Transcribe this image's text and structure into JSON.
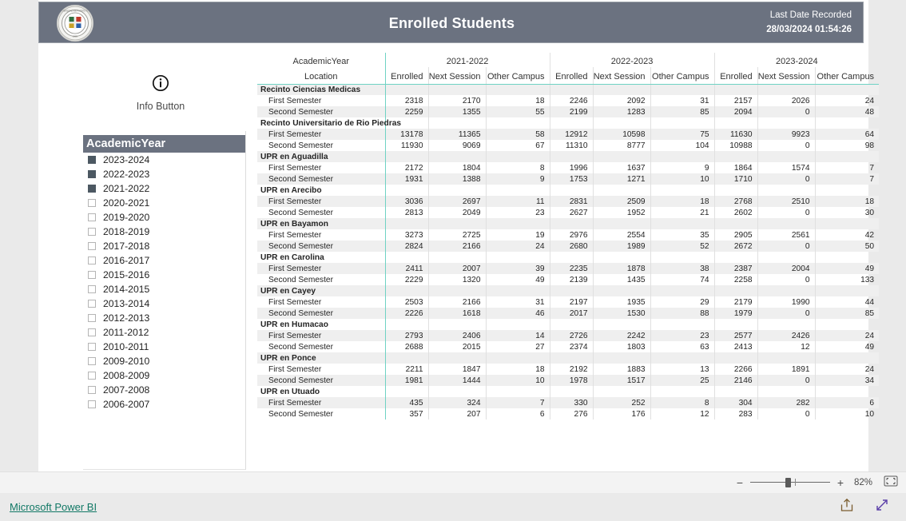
{
  "header": {
    "title": "Enrolled Students",
    "date_label": "Last Date Recorded",
    "date_value": "28/03/2024 01:54:26",
    "logo_name": "university-seal-logo",
    "bg_color": "#6b7280"
  },
  "info_button": {
    "label": "Info Button",
    "icon": "info-circle-icon"
  },
  "slicer": {
    "title": "AcademicYear",
    "items": [
      {
        "label": "2023-2024",
        "checked": true
      },
      {
        "label": "2022-2023",
        "checked": true
      },
      {
        "label": "2021-2022",
        "checked": true
      },
      {
        "label": "2020-2021",
        "checked": false
      },
      {
        "label": "2019-2020",
        "checked": false
      },
      {
        "label": "2018-2019",
        "checked": false
      },
      {
        "label": "2017-2018",
        "checked": false
      },
      {
        "label": "2016-2017",
        "checked": false
      },
      {
        "label": "2015-2016",
        "checked": false
      },
      {
        "label": "2014-2015",
        "checked": false
      },
      {
        "label": "2013-2014",
        "checked": false
      },
      {
        "label": "2012-2013",
        "checked": false
      },
      {
        "label": "2011-2012",
        "checked": false
      },
      {
        "label": "2010-2011",
        "checked": false
      },
      {
        "label": "2009-2010",
        "checked": false
      },
      {
        "label": "2008-2009",
        "checked": false
      },
      {
        "label": "2007-2008",
        "checked": false
      },
      {
        "label": "2006-2007",
        "checked": false
      }
    ]
  },
  "matrix": {
    "corner_top": "AcademicYear",
    "corner_bottom": "Location",
    "year_groups": [
      "2021-2022",
      "2022-2023",
      "2023-2024"
    ],
    "measures": [
      "Enrolled",
      "Next Session",
      "Other Campus"
    ],
    "accent_line_color": "#6fd2c4",
    "rows": [
      {
        "type": "group",
        "label": "Recinto Ciencias Medicas",
        "values": [
          "",
          "",
          "",
          "",
          "",
          "",
          "",
          "",
          ""
        ]
      },
      {
        "type": "item",
        "label": "First Semester",
        "values": [
          "2318",
          "2170",
          "18",
          "2246",
          "2092",
          "31",
          "2157",
          "2026",
          "24"
        ]
      },
      {
        "type": "item",
        "label": "Second Semester",
        "values": [
          "2259",
          "1355",
          "55",
          "2199",
          "1283",
          "85",
          "2094",
          "0",
          "48"
        ]
      },
      {
        "type": "group",
        "label": "Recinto Universitario de Rio Piedras",
        "values": [
          "",
          "",
          "",
          "",
          "",
          "",
          "",
          "",
          ""
        ]
      },
      {
        "type": "item",
        "label": "First Semester",
        "values": [
          "13178",
          "11365",
          "58",
          "12912",
          "10598",
          "75",
          "11630",
          "9923",
          "64"
        ]
      },
      {
        "type": "item",
        "label": "Second Semester",
        "values": [
          "11930",
          "9069",
          "67",
          "11310",
          "8777",
          "104",
          "10988",
          "0",
          "98"
        ]
      },
      {
        "type": "group",
        "label": "UPR en Aguadilla",
        "values": [
          "",
          "",
          "",
          "",
          "",
          "",
          "",
          "",
          ""
        ]
      },
      {
        "type": "item",
        "label": "First Semester",
        "values": [
          "2172",
          "1804",
          "8",
          "1996",
          "1637",
          "9",
          "1864",
          "1574",
          "7"
        ]
      },
      {
        "type": "item",
        "label": "Second Semester",
        "values": [
          "1931",
          "1388",
          "9",
          "1753",
          "1271",
          "10",
          "1710",
          "0",
          "7"
        ]
      },
      {
        "type": "group",
        "label": "UPR en Arecibo",
        "values": [
          "",
          "",
          "",
          "",
          "",
          "",
          "",
          "",
          ""
        ]
      },
      {
        "type": "item",
        "label": "First Semester",
        "values": [
          "3036",
          "2697",
          "11",
          "2831",
          "2509",
          "18",
          "2768",
          "2510",
          "18"
        ]
      },
      {
        "type": "item",
        "label": "Second Semester",
        "values": [
          "2813",
          "2049",
          "23",
          "2627",
          "1952",
          "21",
          "2602",
          "0",
          "30"
        ]
      },
      {
        "type": "group",
        "label": "UPR en Bayamon",
        "values": [
          "",
          "",
          "",
          "",
          "",
          "",
          "",
          "",
          ""
        ]
      },
      {
        "type": "item",
        "label": "First Semester",
        "values": [
          "3273",
          "2725",
          "19",
          "2976",
          "2554",
          "35",
          "2905",
          "2561",
          "42"
        ]
      },
      {
        "type": "item",
        "label": "Second Semester",
        "values": [
          "2824",
          "2166",
          "24",
          "2680",
          "1989",
          "52",
          "2672",
          "0",
          "50"
        ]
      },
      {
        "type": "group",
        "label": "UPR en Carolina",
        "values": [
          "",
          "",
          "",
          "",
          "",
          "",
          "",
          "",
          ""
        ]
      },
      {
        "type": "item",
        "label": "First Semester",
        "values": [
          "2411",
          "2007",
          "39",
          "2235",
          "1878",
          "38",
          "2387",
          "2004",
          "49"
        ]
      },
      {
        "type": "item",
        "label": "Second Semester",
        "values": [
          "2229",
          "1320",
          "49",
          "2139",
          "1435",
          "74",
          "2258",
          "0",
          "133"
        ]
      },
      {
        "type": "group",
        "label": "UPR en Cayey",
        "values": [
          "",
          "",
          "",
          "",
          "",
          "",
          "",
          "",
          ""
        ]
      },
      {
        "type": "item",
        "label": "First Semester",
        "values": [
          "2503",
          "2166",
          "31",
          "2197",
          "1935",
          "29",
          "2179",
          "1990",
          "44"
        ]
      },
      {
        "type": "item",
        "label": "Second Semester",
        "values": [
          "2226",
          "1618",
          "46",
          "2017",
          "1530",
          "88",
          "1979",
          "0",
          "85"
        ]
      },
      {
        "type": "group",
        "label": "UPR en Humacao",
        "values": [
          "",
          "",
          "",
          "",
          "",
          "",
          "",
          "",
          ""
        ]
      },
      {
        "type": "item",
        "label": "First Semester",
        "values": [
          "2793",
          "2406",
          "14",
          "2726",
          "2242",
          "23",
          "2577",
          "2426",
          "24"
        ]
      },
      {
        "type": "item",
        "label": "Second Semester",
        "values": [
          "2688",
          "2015",
          "27",
          "2374",
          "1803",
          "63",
          "2413",
          "12",
          "49"
        ]
      },
      {
        "type": "group",
        "label": "UPR en Ponce",
        "values": [
          "",
          "",
          "",
          "",
          "",
          "",
          "",
          "",
          ""
        ]
      },
      {
        "type": "item",
        "label": "First Semester",
        "values": [
          "2211",
          "1847",
          "18",
          "2192",
          "1883",
          "13",
          "2266",
          "1891",
          "24"
        ]
      },
      {
        "type": "item",
        "label": "Second Semester",
        "values": [
          "1981",
          "1444",
          "10",
          "1978",
          "1517",
          "25",
          "2146",
          "0",
          "34"
        ]
      },
      {
        "type": "group",
        "label": "UPR en Utuado",
        "values": [
          "",
          "",
          "",
          "",
          "",
          "",
          "",
          "",
          ""
        ]
      },
      {
        "type": "item",
        "label": "First Semester",
        "values": [
          "435",
          "324",
          "7",
          "330",
          "252",
          "8",
          "304",
          "282",
          "6"
        ]
      },
      {
        "type": "item",
        "label": "Second Semester",
        "values": [
          "357",
          "207",
          "6",
          "276",
          "176",
          "12",
          "283",
          "0",
          "10"
        ]
      }
    ]
  },
  "zoombar": {
    "minus": "−",
    "plus": "+",
    "value": "82%",
    "fit_icon": "fit-to-page-icon"
  },
  "footer": {
    "brand": "Microsoft Power BI",
    "brand_color": "#117865",
    "share_icon": "share-icon",
    "fullscreen_icon": "fullscreen-icon"
  }
}
